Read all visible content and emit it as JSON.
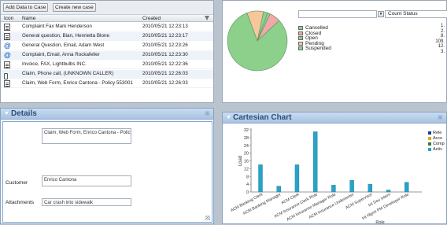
{
  "list": {
    "toolbar": {
      "add_label": "Add Data to Case",
      "create_label": "Create new case"
    },
    "columns": {
      "icon": "Icon",
      "name": "Name",
      "created": "Created"
    },
    "rows": [
      {
        "icon": "document-icon",
        "name": "Complaint Fax Mark Henderson",
        "created": "2010/05/21 12:23:13"
      },
      {
        "icon": "document-icon",
        "name": "General question, Bian, Henrietta Blone",
        "created": "2010/05/21 12:23:17"
      },
      {
        "icon": "at-email-icon",
        "name": "General Question, Email, Adam West",
        "created": "2010/05/21 12:23:26"
      },
      {
        "icon": "at-email-icon",
        "name": "Complaint, Email, Anna Rockafeller",
        "created": "2010/05/21 12:23:30"
      },
      {
        "icon": "document-icon",
        "name": "Invoice, FAX, Lightbulbs INC.",
        "created": "2010/05/21 12:22:36"
      },
      {
        "icon": "phone-icon",
        "name": "Claim, Phone call, (UNKNOWN CALLER)",
        "created": "2010/05/21 12:26:03"
      },
      {
        "icon": "web-form-icon",
        "name": "Claim, Web Form, Enrico Cantona - Policy 553001",
        "created": "2010/05/21 12:26:03"
      }
    ]
  },
  "details": {
    "title": "Details",
    "case_value": "Claim, Web Form, Enrico Cantona - Policy",
    "customer_label": "Customer",
    "customer_value": "Enrico Cantona",
    "attachments_label": "Attachments",
    "attachments_value": "Car crash into sidewalk"
  },
  "pie": {
    "select_value": "",
    "select_right_value": "Count Status",
    "colors": {
      "Cancelled": "#8fd18f",
      "Closed": "#f3a8a8",
      "Open": "#8cd08c",
      "Pending": "#f7c79c",
      "Suspended": "#8fd18f"
    },
    "counts": [
      "1.",
      "2.",
      "8.",
      "109.",
      "12.",
      "3."
    ]
  },
  "chart_data": [
    {
      "type": "pie",
      "categories": [
        "Cancelled",
        "Closed",
        "Open",
        "Pending",
        "Suspended"
      ],
      "values": [
        2,
        8,
        109,
        12,
        3
      ],
      "title": "",
      "xlabel": "",
      "ylabel": ""
    },
    {
      "type": "bar",
      "title": "Cartesian Chart",
      "categories": [
        "ACM Banking Clerk",
        "ACM Banking Manager",
        "ACM Clerk",
        "ACM Insurance Clerk Role",
        "ACM Insurance Manager Role",
        "ACM Insurance Underwriter",
        "ACM Supervisor",
        "Int Dev Intern",
        "Int Mgmt PM Developer Role"
      ],
      "values": [
        14,
        3,
        14,
        31,
        3.5,
        6,
        4,
        1,
        5
      ],
      "ylim": [
        0,
        32
      ],
      "yticks": [
        0,
        4,
        8,
        12,
        16,
        20,
        24,
        28,
        32
      ],
      "ylabel": "Load",
      "xlabel": "Role",
      "grid": false,
      "color": "#27a3c9",
      "legend": [
        "Rele",
        "Acce",
        "Comp",
        "Activ"
      ],
      "legend_colors": [
        "#1c3f8f",
        "#e8a41b",
        "#3c7a3c",
        "#27a3c9"
      ]
    }
  ]
}
